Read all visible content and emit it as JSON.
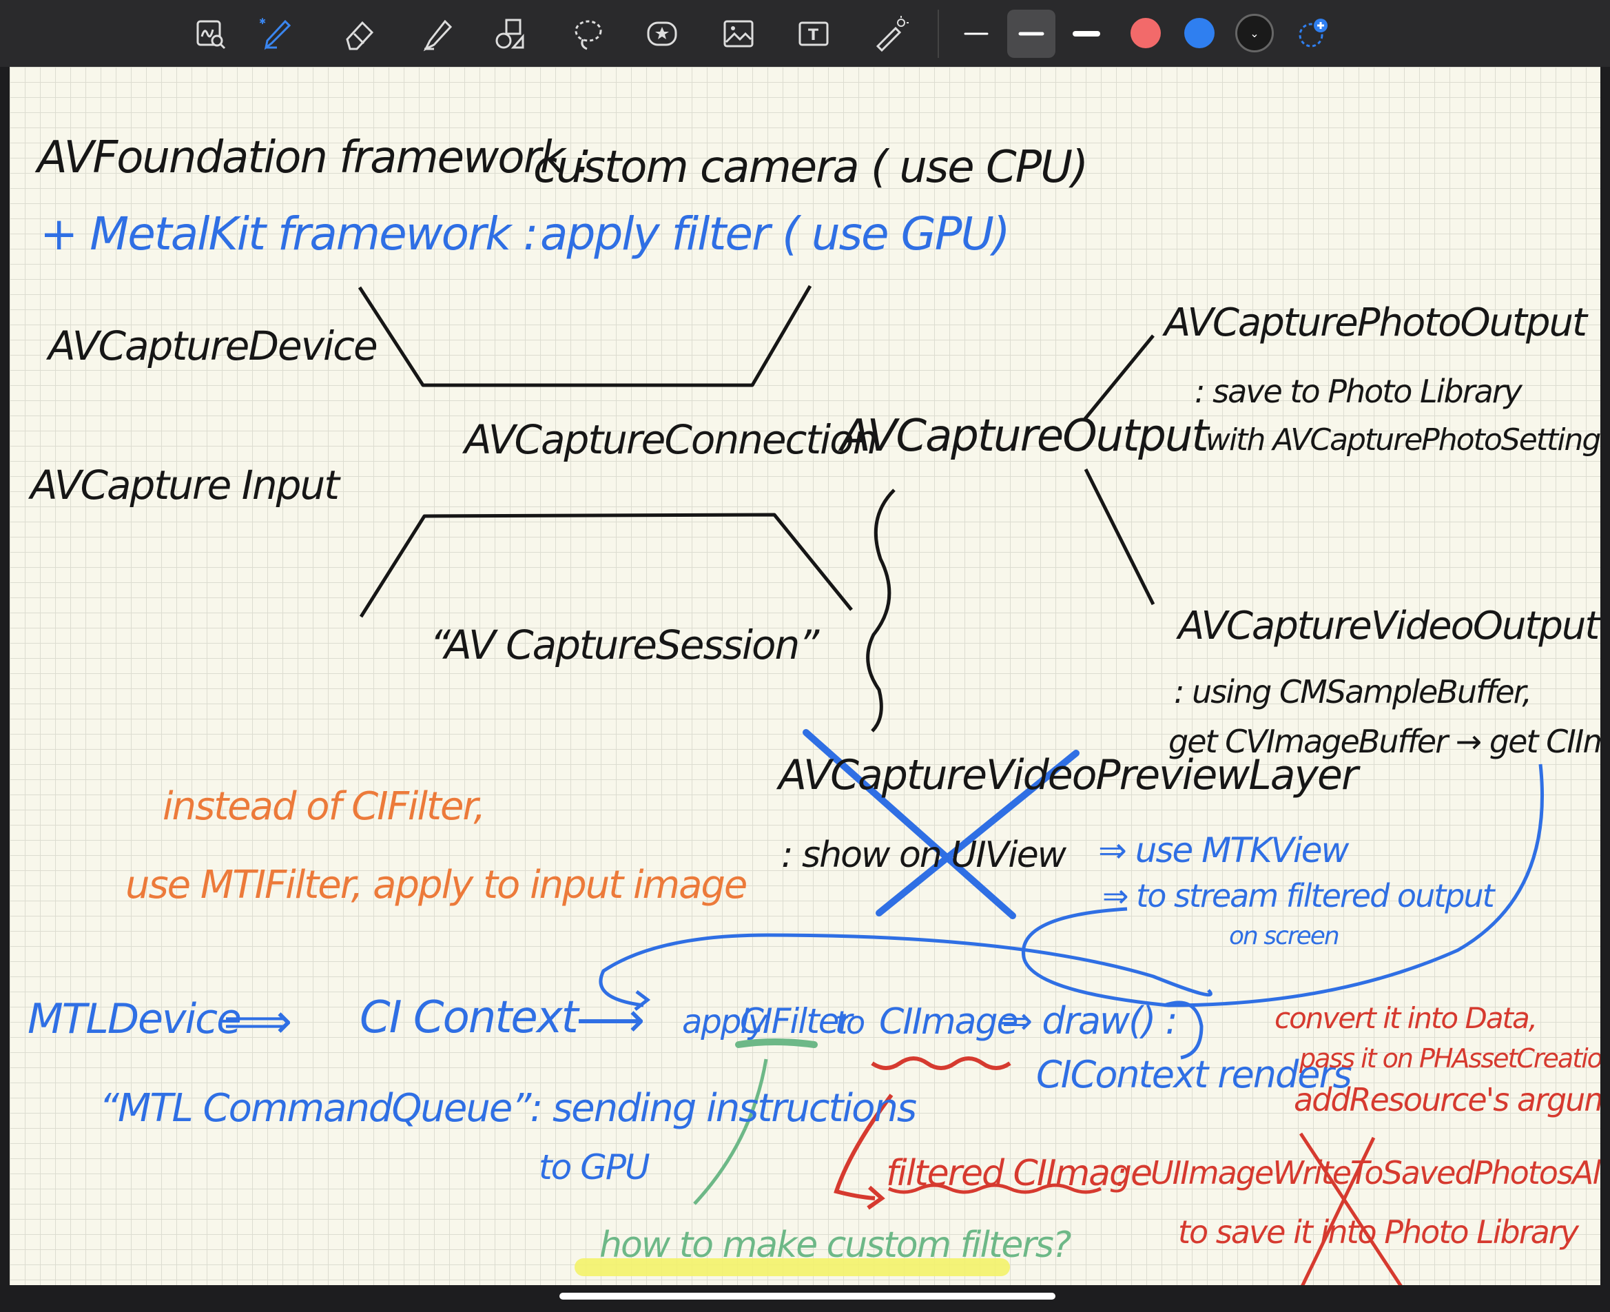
{
  "toolbar": {
    "tools": [
      {
        "icon": "lasso-zoom-icon"
      },
      {
        "icon": "pen-icon",
        "badge": "bluetooth-icon"
      },
      {
        "icon": "eraser-icon"
      },
      {
        "icon": "highlighter-icon"
      },
      {
        "icon": "shapes-icon"
      },
      {
        "icon": "lasso-icon"
      },
      {
        "icon": "sticker-icon"
      },
      {
        "icon": "image-icon"
      },
      {
        "icon": "text-box-icon"
      },
      {
        "icon": "laser-pointer-icon"
      }
    ],
    "stroke_widths": [
      "thin",
      "medium",
      "thick"
    ],
    "selected_stroke": "medium",
    "colors": [
      "#f26a6a",
      "#2f7ff0",
      "#1a1a1a"
    ],
    "selected_color": "#1a1a1a",
    "add_color_icon": "add-color-icon"
  },
  "notes": {
    "line1_title": "AVFoundation framework :",
    "line1_rest": "custom camera ( use CPU)",
    "line2_title": "+ MetalKit framework :",
    "line2_rest": "apply filter ( use GPU)",
    "device": "AVCaptureDevice",
    "input": "AVCapture Input",
    "connection": "AVCaptureConnection",
    "session": "“AV CaptureSession”",
    "output": "AVCaptureOutput",
    "photo_output": "AVCapturePhotoOutput",
    "photo_desc1": ": save to Photo Library",
    "photo_desc2": "with AVCapturePhotoSettings",
    "video_output": "AVCaptureVideoOutput",
    "video_desc1": ": using CMSampleBuffer,",
    "video_desc2": "get CVImageBuffer → get CIImage",
    "preview_layer": "AVCaptureVideoPreviewLayer",
    "show_on": ": show on UIView",
    "use_mtkview": "⇒ use MTKView",
    "stream": "⇒ to stream filtered output",
    "on_screen": "on screen",
    "instead1": "instead of CIFilter,",
    "instead2": "use MTIFilter, apply to input image",
    "mtldevice": "MTLDevice",
    "arrow_double": "⟹",
    "cicontext": "CI Context",
    "arrow_single": "⟶",
    "apply": "apply",
    "cifilter": "CIFilter",
    "to": "to",
    "ciimage": "CIImage",
    "draw": "⇒ draw() :",
    "renders": "CIContext renders",
    "queue": "“MTL CommandQueue”: sending instructions",
    "to_gpu": "to GPU",
    "convert1": "convert it into Data,",
    "convert2": "pass it on PHAssetCreationRequest",
    "convert3": "addResource's argument",
    "filtered": "filtered CIImage",
    "colon": ":",
    "uiimagewrite": "UIImageWriteToSavedPhotosAlbum",
    "to_save": "to save it into Photo Library",
    "custom_filters": "how to make custom filters?"
  },
  "colors": {
    "ink_black": "#161616",
    "ink_blue": "#2f6fe4",
    "ink_orange": "#ec7a3a",
    "ink_red": "#d63a2f",
    "ink_green": "#6db887",
    "highlighter_yellow": "#f3f26a",
    "paper": "#f8f7eb"
  }
}
